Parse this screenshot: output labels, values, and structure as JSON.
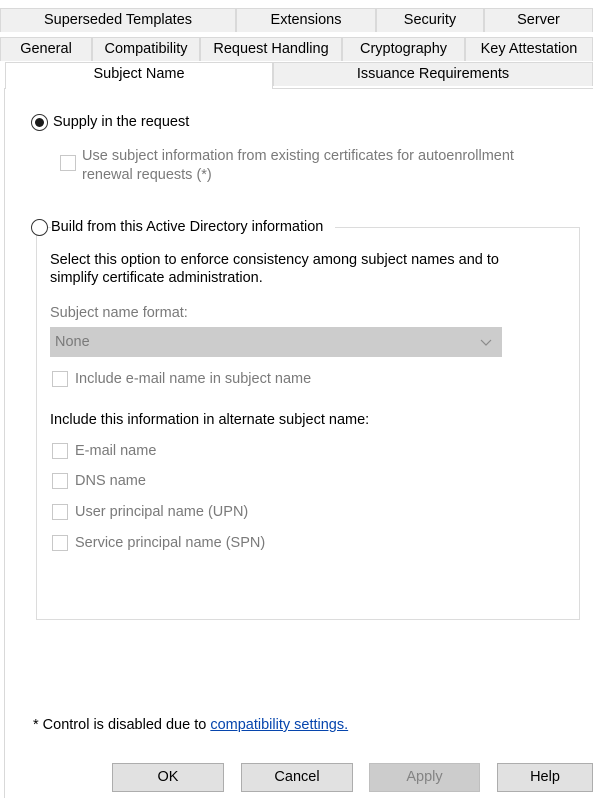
{
  "tabs_row1": [
    "Superseded Templates",
    "Extensions",
    "Security",
    "Server"
  ],
  "tabs_row2": [
    "General",
    "Compatibility",
    "Request Handling",
    "Cryptography",
    "Key Attestation"
  ],
  "tabs_row3": [
    "Subject Name",
    "Issuance Requirements"
  ],
  "active_tab": "Subject Name",
  "supply": {
    "label": "Supply in the request",
    "selected": true,
    "autoenroll_line1": "Use subject information from existing certificates for autoenrollment",
    "autoenroll_line2": "renewal requests (*)"
  },
  "build": {
    "label": "Build from this Active Directory information",
    "selected": false,
    "desc_line1": "Select this option to enforce consistency among subject names and to",
    "desc_line2": "simplify certificate administration.",
    "format_label": "Subject name format:",
    "format_value": "None",
    "include_email": "Include e-mail name in subject name",
    "alt_heading": "Include this information in alternate subject name:",
    "alt_items": [
      "E-mail name",
      "DNS name",
      "User principal name (UPN)",
      "Service principal name (SPN)"
    ]
  },
  "footer": {
    "note": "* Control is disabled due to",
    "link": "compatibility settings."
  },
  "buttons": {
    "ok": "OK",
    "cancel": "Cancel",
    "apply": "Apply",
    "help": "Help"
  }
}
